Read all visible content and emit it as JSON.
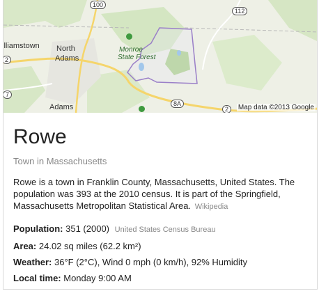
{
  "map": {
    "labels": {
      "williamstown": "illiamstown",
      "north": "North",
      "adams1": "Adams",
      "adams2": "Adams",
      "monroe": "Monroe",
      "state_forest": "State Forest",
      "rowe_town": "Rowe"
    },
    "route_shields": {
      "r100": "100",
      "r112": "112",
      "r2a": "2",
      "r7": "7",
      "r8a": "8A",
      "r2b": "2"
    },
    "attribution": "Map data ©2013 Google"
  },
  "place": {
    "name": "Rowe",
    "type": "Town in Massachusetts",
    "description": "Rowe is a town in Franklin County, Massachusetts, United States. The population was 393 at the 2010 census. It is part of the Springfield, Massachusetts Metropolitan Statistical Area.",
    "description_source": "Wikipedia"
  },
  "facts": {
    "population": {
      "label": "Population:",
      "value": "351 (2000)",
      "source": "United States Census Bureau"
    },
    "area": {
      "label": "Area:",
      "value": "24.02 sq miles (62.2 km²)"
    },
    "weather": {
      "label": "Weather:",
      "value": "36°F (2°C), Wind 0 mph (0 km/h), 92% Humidity"
    },
    "local_time": {
      "label": "Local time:",
      "value": "Monday 9:00 AM"
    }
  },
  "colors": {
    "boundary": "#9a7fc8",
    "road": "#f5d56b",
    "forest": "#c8dfb0",
    "water": "#7fb7e8"
  },
  "icons": [
    "forest-tree-icon",
    "route-shield-icon"
  ]
}
